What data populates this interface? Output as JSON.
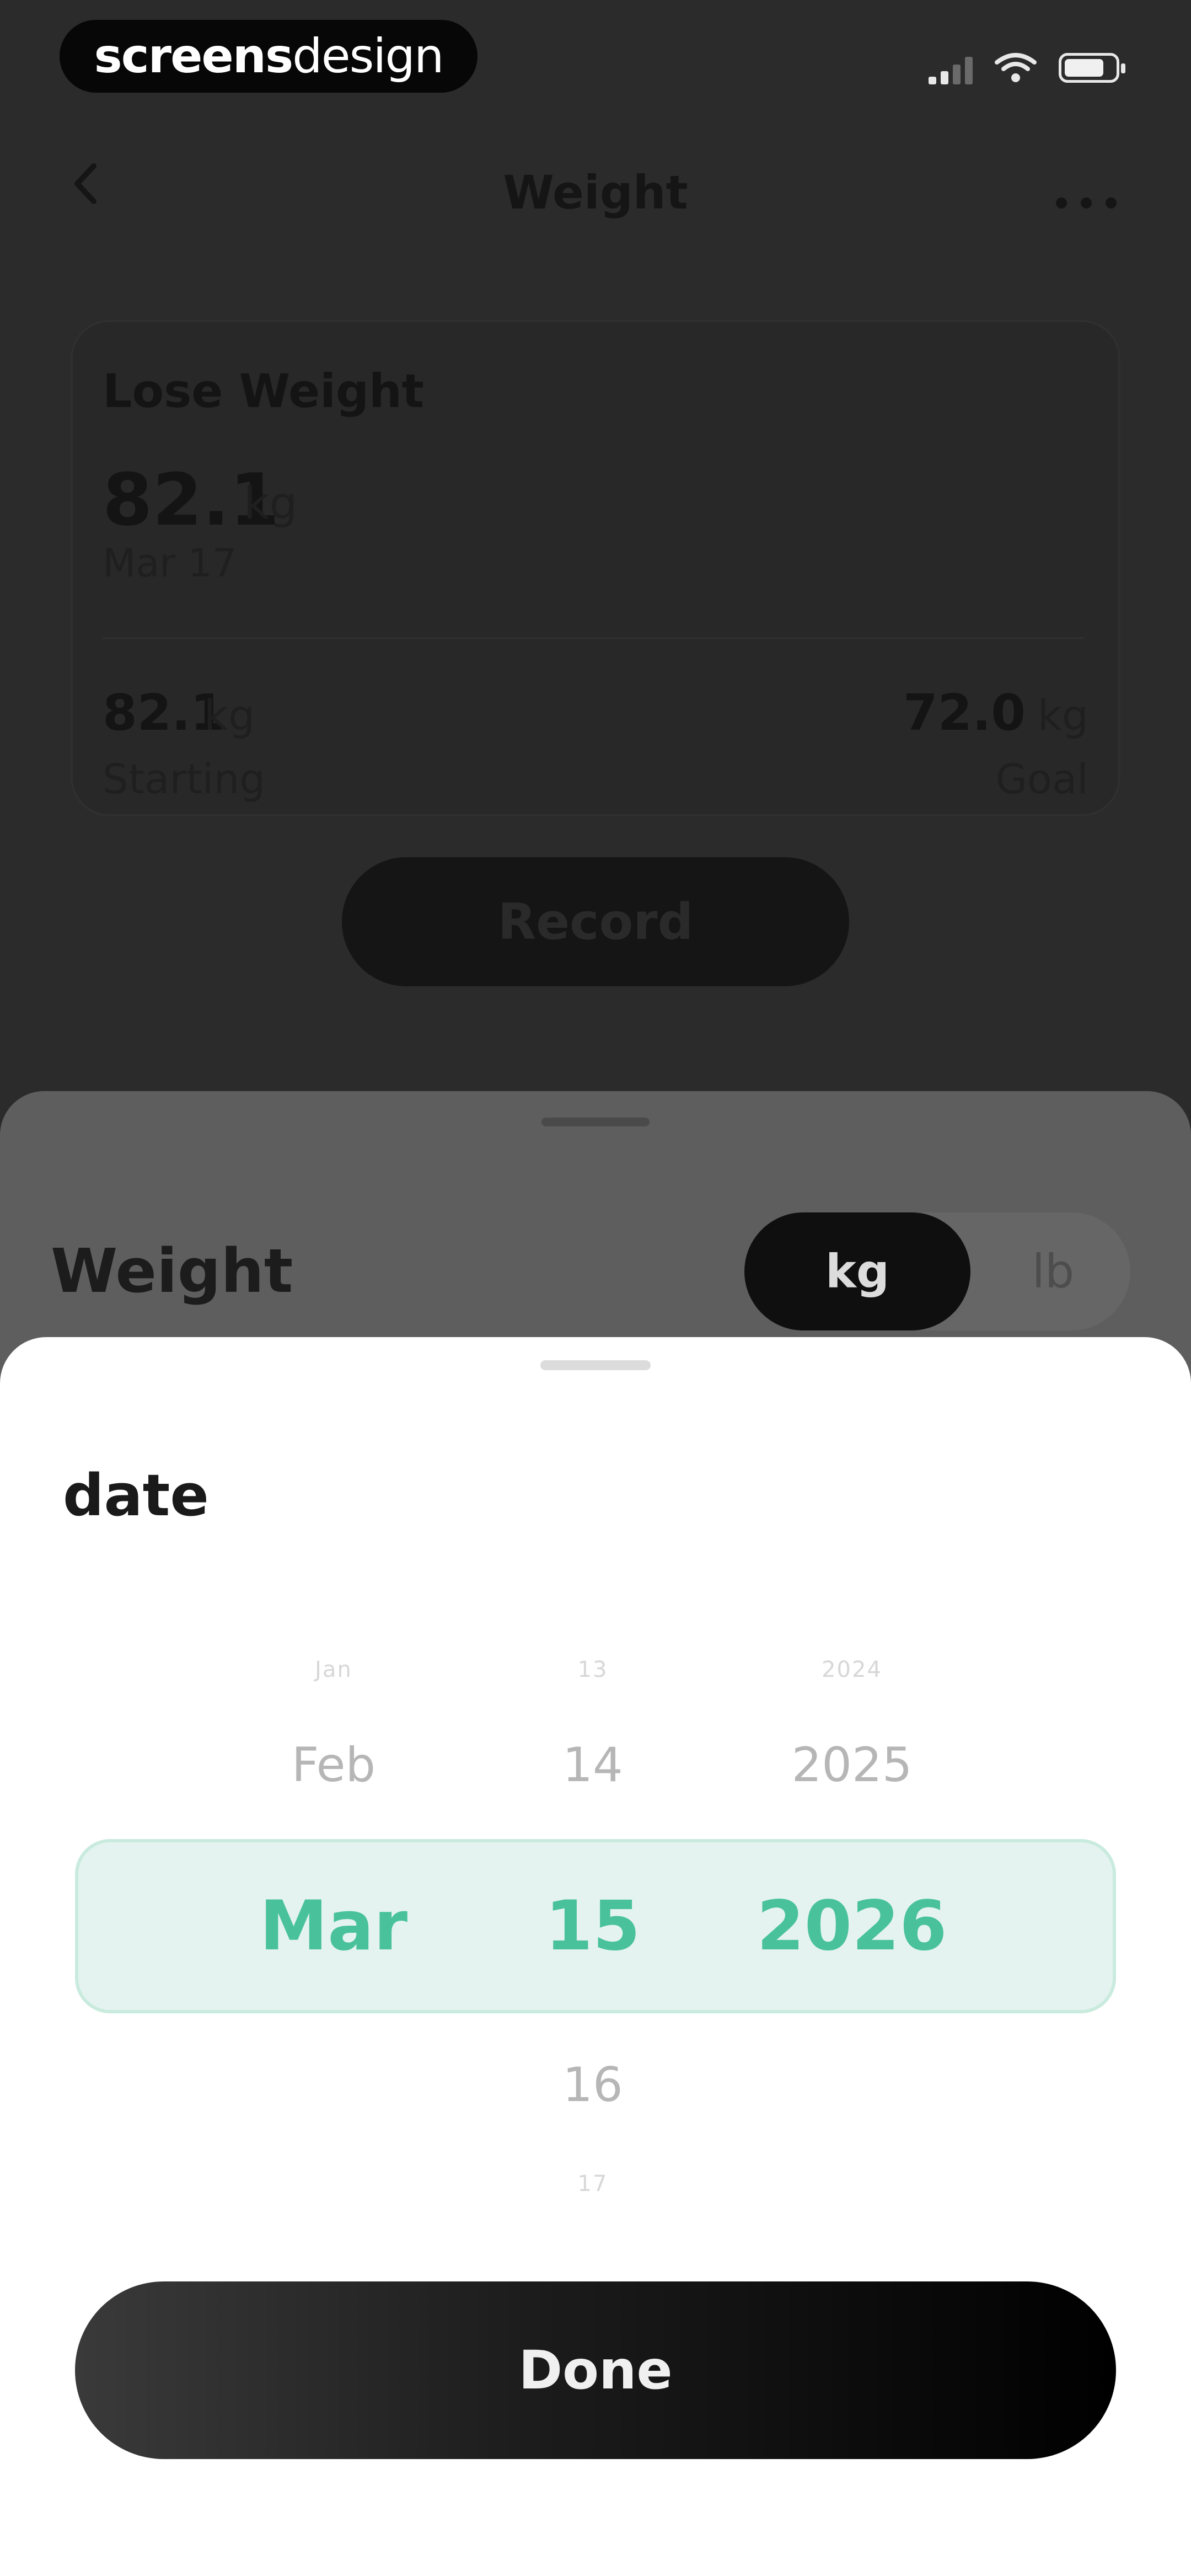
{
  "status_bar": {
    "brand_bold": "screens",
    "brand_regular": "design"
  },
  "nav": {
    "back_icon": "chevron-left-icon",
    "title": "Weight",
    "more_icon": "more-icon"
  },
  "goal_card": {
    "title": "Lose Weight",
    "current_value": "82.1",
    "current_unit": "kg",
    "current_date": "Mar 17",
    "starting_value": "82.1",
    "starting_unit": "kg",
    "starting_label": "Starting",
    "goal_value": "72.0",
    "goal_unit": "kg",
    "goal_label": "Goal",
    "record_label": "Record"
  },
  "weight_sheet": {
    "title": "Weight",
    "unit_options": [
      "kg",
      "lb"
    ],
    "selected_unit": "kg"
  },
  "date_sheet": {
    "title": "date",
    "months": {
      "far_above": "Jan",
      "above": "Feb",
      "selected": "Mar"
    },
    "days": {
      "far_above": "13",
      "above": "14",
      "selected": "15",
      "below": "16",
      "far_below": "17"
    },
    "years": {
      "far_above": "2024",
      "above": "2025",
      "selected": "2026"
    },
    "done_label": "Done",
    "accent_color": "#49C29B"
  }
}
